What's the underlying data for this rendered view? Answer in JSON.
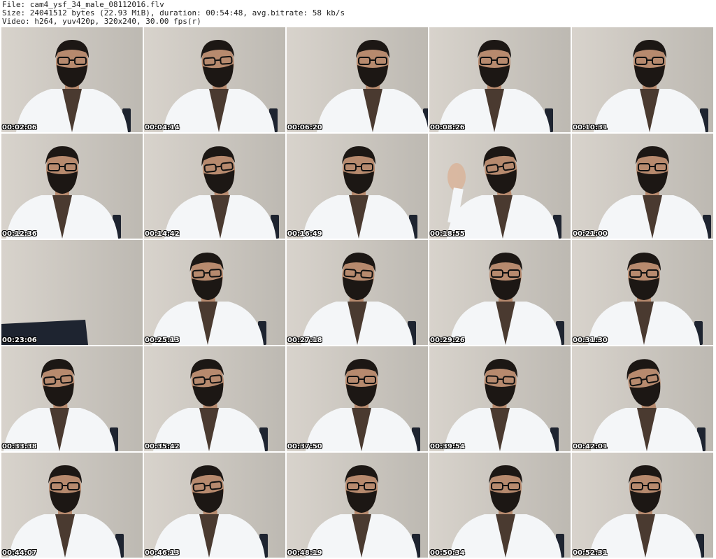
{
  "header": {
    "file_line": "File: cam4_ysf_34_male_08112016.flv",
    "size_line": "Size: 24041512 bytes (22.93 MiB), duration: 00:54:48, avg.bitrate: 58 kb/s",
    "video_line": "Video: h264, yuv420p, 320x240, 30.00 fps(r)"
  },
  "colors": {
    "background": "#ffffff",
    "wall": "#cfcbc4",
    "shirt": "#f4f6f8",
    "skin": "#b78a6e",
    "hair": "#1c1714",
    "chair": "#1e2430"
  },
  "thumbnails": [
    {
      "timestamp": "00:02:06",
      "content": "person"
    },
    {
      "timestamp": "00:04:14",
      "content": "person"
    },
    {
      "timestamp": "00:06:20",
      "content": "person"
    },
    {
      "timestamp": "00:08:26",
      "content": "person"
    },
    {
      "timestamp": "00:10:31",
      "content": "person"
    },
    {
      "timestamp": "00:12:36",
      "content": "person"
    },
    {
      "timestamp": "00:14:42",
      "content": "person"
    },
    {
      "timestamp": "00:16:49",
      "content": "person"
    },
    {
      "timestamp": "00:18:55",
      "content": "person-waving"
    },
    {
      "timestamp": "00:21:00",
      "content": "person"
    },
    {
      "timestamp": "00:23:06",
      "content": "empty-wall"
    },
    {
      "timestamp": "00:25:13",
      "content": "person"
    },
    {
      "timestamp": "00:27:18",
      "content": "person"
    },
    {
      "timestamp": "00:29:26",
      "content": "person"
    },
    {
      "timestamp": "00:31:30",
      "content": "person"
    },
    {
      "timestamp": "00:33:38",
      "content": "person"
    },
    {
      "timestamp": "00:35:42",
      "content": "person"
    },
    {
      "timestamp": "00:37:50",
      "content": "person"
    },
    {
      "timestamp": "00:39:54",
      "content": "person"
    },
    {
      "timestamp": "00:42:01",
      "content": "person"
    },
    {
      "timestamp": "00:44:07",
      "content": "person"
    },
    {
      "timestamp": "00:46:13",
      "content": "person"
    },
    {
      "timestamp": "00:48:19",
      "content": "person"
    },
    {
      "timestamp": "00:50:34",
      "content": "person"
    },
    {
      "timestamp": "00:52:31",
      "content": "person"
    }
  ]
}
